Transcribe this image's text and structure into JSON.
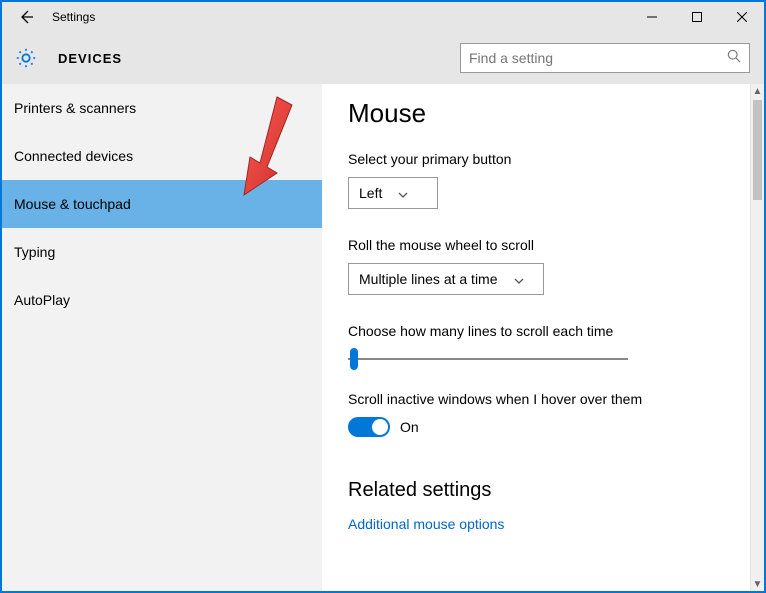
{
  "window": {
    "title": "Settings"
  },
  "header": {
    "title": "DEVICES"
  },
  "search": {
    "placeholder": "Find a setting"
  },
  "sidebar": {
    "items": [
      {
        "label": "Printers & scanners",
        "active": false
      },
      {
        "label": "Connected devices",
        "active": false
      },
      {
        "label": "Mouse & touchpad",
        "active": true
      },
      {
        "label": "Typing",
        "active": false
      },
      {
        "label": "AutoPlay",
        "active": false
      }
    ]
  },
  "main": {
    "heading": "Mouse",
    "primaryButton": {
      "label": "Select your primary button",
      "value": "Left"
    },
    "scrollWheel": {
      "label": "Roll the mouse wheel to scroll",
      "value": "Multiple lines at a time"
    },
    "linesSlider": {
      "label": "Choose how many lines to scroll each time",
      "value": 3,
      "min": 1,
      "max": 100
    },
    "hoverScroll": {
      "label": "Scroll inactive windows when I hover over them",
      "value": true,
      "stateText": "On"
    },
    "related": {
      "heading": "Related settings",
      "link": "Additional mouse options"
    }
  },
  "colors": {
    "accent": "#0178d7"
  }
}
